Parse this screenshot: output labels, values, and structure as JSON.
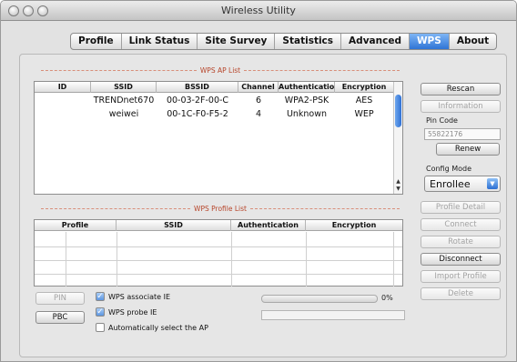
{
  "window": {
    "title": "Wireless Utility"
  },
  "tabs": [
    {
      "label": "Profile"
    },
    {
      "label": "Link Status"
    },
    {
      "label": "Site Survey"
    },
    {
      "label": "Statistics"
    },
    {
      "label": "Advanced"
    },
    {
      "label": "WPS",
      "active": true
    },
    {
      "label": "About"
    }
  ],
  "ap_list": {
    "title": "WPS AP List",
    "columns": [
      "ID",
      "SSID",
      "BSSID",
      "Channel",
      "Authenticatio",
      "Encryption"
    ],
    "rows": [
      {
        "id": "",
        "ssid": "TRENDnet670",
        "bssid": "00-03-2F-00-C",
        "channel": "6",
        "auth": "WPA2-PSK",
        "encryption": "AES"
      },
      {
        "id": "",
        "ssid": "weiwei",
        "bssid": "00-1C-F0-F5-2",
        "channel": "4",
        "auth": "Unknown",
        "encryption": "WEP"
      }
    ]
  },
  "profile_list": {
    "title": "WPS Profile List",
    "columns": [
      "Profile",
      "SSID",
      "Authentication",
      "Encryption"
    ]
  },
  "right_panel": {
    "rescan": "Rescan",
    "information": "Information",
    "pin_code_label": "Pin Code",
    "pin_code_value": "55822176",
    "renew": "Renew",
    "config_mode_label": "Config Mode",
    "config_mode_value": "Enrollee",
    "profile_detail": "Profile Detail",
    "connect": "Connect",
    "rotate": "Rotate",
    "disconnect": "Disconnect",
    "import_profile": "Import Profile",
    "delete": "Delete"
  },
  "bottom": {
    "pin": "PIN",
    "pbc": "PBC",
    "wps_associate_ie": "WPS associate IE",
    "wps_probe_ie": "WPS probe IE",
    "auto_select": "Automatically select the AP",
    "progress_percent": 0,
    "progress_label": "0%"
  },
  "colors": {
    "accent": "#2f74d6",
    "section_title": "#b7452a"
  }
}
